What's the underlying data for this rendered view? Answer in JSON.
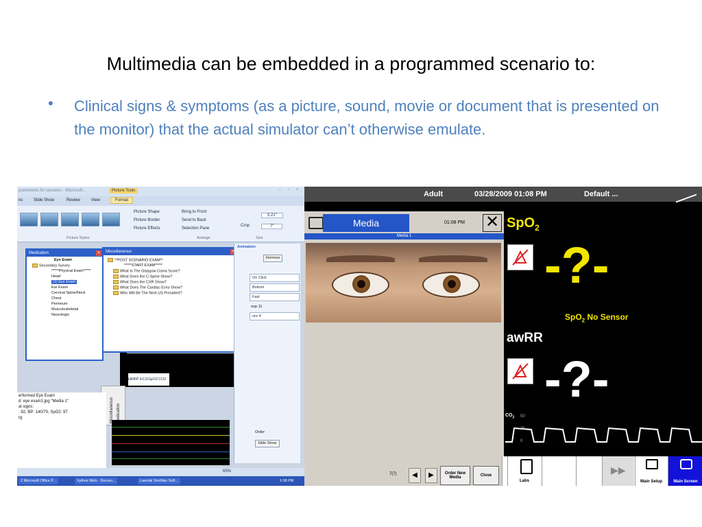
{
  "slide": {
    "title": "Multimedia can be embedded in a programmed scenario to:",
    "bullet_char": "•",
    "bullet_text": "Clinical signs & symptoms (as a picture, sound, movie or document that is presented on the monitor) that the actual simulator can’t otherwise emulate.",
    "accent_color": "#4f81bd"
  },
  "left_screenshot": {
    "window_title": "quirements for sessions - Microsoft...",
    "tool_tab": "Picture Tools",
    "window_controls": "– ▫ ×",
    "ribbon_tabs": [
      "ns",
      "Slide Show",
      "Review",
      "View",
      "Format"
    ],
    "ribbon_commands": {
      "picture_shape": "Picture Shape",
      "picture_border": "Picture Border",
      "picture_effects": "Picture Effects",
      "bring_to_front": "Bring to Front",
      "send_to_back": "Send to Back",
      "selection_pane": "Selection Pane",
      "crop": "Crop",
      "height": "5.21\"",
      "width": "7\""
    },
    "ribbon_groups": [
      "Picture Styles",
      "Arrange",
      "Size"
    ],
    "medication_panel": {
      "title": "Medication",
      "header": "Eye Exam",
      "items": [
        "Secondary Survey",
        "*****Physical Exam*****",
        "Head",
        "(1) Eye Exam",
        "Ear Exam",
        "Cervical Spine/Neck",
        "Chest",
        "Perineum",
        "Musculoskeletal",
        "Neurologic"
      ]
    },
    "misc_panel": {
      "title": "Miscellaneous",
      "items": [
        "**POST SCENARIO EXAM**",
        "*****START EXAM*****",
        "What Is The Glasgow Coma Score?",
        "What Does the C-Spine Show?",
        "What Does the CXR Show?",
        "What Does The Cardiac Echo Show?",
        "Who Will Be The Next US President?"
      ]
    },
    "animation_panel": {
      "title": "Animation",
      "remove": "Remove",
      "start": "On Click",
      "direction": "Bottom",
      "speed": "Fast",
      "group": "oup 11",
      "picture": "ure 4",
      "reorder": "Order",
      "slideshow": "Slide Show"
    },
    "vitals_tabs": [
      "HR",
      "BP",
      "ECG",
      "SpO2",
      "CO2"
    ],
    "side_tabs": [
      "ABC",
      "Miscellaneous",
      "Medication"
    ],
    "log_lines": [
      "erformed Eye Exam",
      "d: eye exam1.jpg \"Media 1\"",
      "al signs:",
      ": 92, BP: 140/70, SpO2: 97",
      "rg"
    ],
    "zoom": "65%",
    "taskbar": {
      "items": [
        "2 Microsoft Office P...",
        "Xythos Web - Docum...",
        "Laerdal SimMan Soft..."
      ],
      "time": "1:08 PM"
    },
    "colors": {
      "panel_blue": "#2e5fc8",
      "taskbar_blue": "#2c55b8"
    }
  },
  "right_screenshot": {
    "top_bar": {
      "patient": "Adult",
      "datetime": "03/28/2009 01:08 PM",
      "profile": "Default ..."
    },
    "media_window": {
      "tab_label": "Media",
      "time": "01:08 PM",
      "close_glyph": "✕",
      "subtitle": "Media 1",
      "counter": "7(7)",
      "prev": "◀",
      "next": "▶",
      "order_new_media": "Order New Media",
      "close_button": "Close"
    },
    "vitals": {
      "spo2_label": "SpO",
      "spo2_sub": "2",
      "spo2_value": "-?-",
      "spo2_status": "SpO",
      "spo2_status_sub": "2",
      "spo2_status_rest": " No Sensor",
      "awrr_label": "awRR",
      "awrr_value": "-?-",
      "co2_label": "CO",
      "co2_sub": "2",
      "co2_scale_top": "50",
      "co2_scale_mid": "25",
      "co2_scale_low": "0"
    },
    "bottom_buttons": {
      "labs": "Labs",
      "forward": "▶▶",
      "main_setup": "Main Setup",
      "main_screen": "Main Screen"
    },
    "colors": {
      "vital_yellow": "#f2e600",
      "media_blue": "#2456c8",
      "button_blue": "#1212d8"
    }
  }
}
